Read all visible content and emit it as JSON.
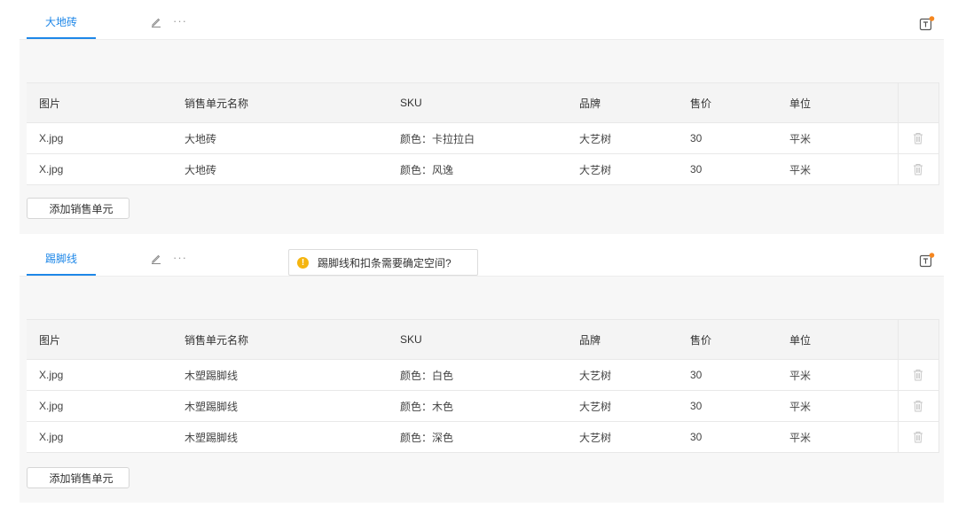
{
  "colors": {
    "accent": "#1e87e8",
    "warning": "#f5b50f",
    "notification_dot": "#f5861f",
    "panel_background": "#f7f7f7"
  },
  "columns": [
    "图片",
    "销售单元名称",
    "SKU",
    "品牌",
    "售价",
    "单位"
  ],
  "cards": [
    {
      "tab_label": "大地砖",
      "more_label": "···",
      "add_button_label": "添加销售单元",
      "rows": [
        {
          "image": "X.jpg",
          "name": "大地砖",
          "sku": "颜色：卡拉拉白",
          "brand": "大艺树",
          "price": "30",
          "unit": "平米"
        },
        {
          "image": "X.jpg",
          "name": "大地砖",
          "sku": "颜色：风逸",
          "brand": "大艺树",
          "price": "30",
          "unit": "平米"
        }
      ]
    },
    {
      "tab_label": "踢脚线",
      "more_label": "···",
      "tooltip_text": "踢脚线和扣条需要确定空间?",
      "add_button_label": "添加销售单元",
      "rows": [
        {
          "image": "X.jpg",
          "name": "木塑踢脚线",
          "sku": "颜色：白色",
          "brand": "大艺树",
          "price": "30",
          "unit": "平米"
        },
        {
          "image": "X.jpg",
          "name": "木塑踢脚线",
          "sku": "颜色：木色",
          "brand": "大艺树",
          "price": "30",
          "unit": "平米"
        },
        {
          "image": "X.jpg",
          "name": "木塑踢脚线",
          "sku": "颜色：深色",
          "brand": "大艺树",
          "price": "30",
          "unit": "平米"
        }
      ]
    }
  ],
  "icons": {
    "edit": "pencil-icon",
    "more": "more-dots-icon",
    "corner": "text-box-icon",
    "delete": "trash-icon",
    "warning": "warning-icon"
  }
}
